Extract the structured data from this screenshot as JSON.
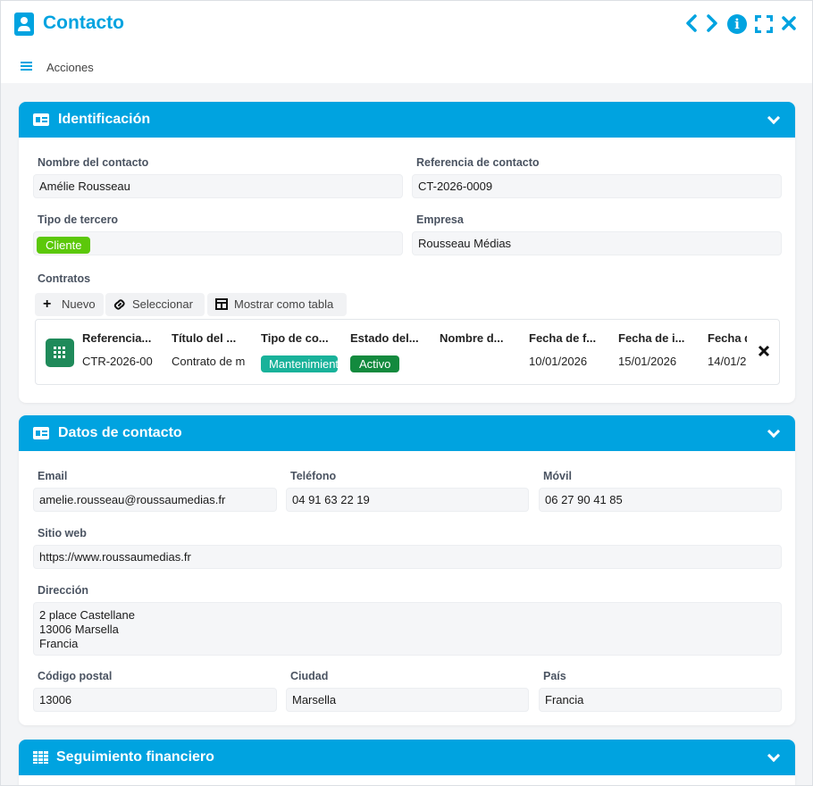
{
  "window": {
    "title": "Contacto",
    "icons": [
      "person-badge-icon",
      "chevron-left-icon",
      "chevron-right-icon",
      "info-icon",
      "fullscreen-icon",
      "close-icon"
    ]
  },
  "menubar": {
    "label": "Acciones"
  },
  "identificacion": {
    "title": "Identificación",
    "nombre_label": "Nombre del contacto",
    "nombre_value": "Amélie Rousseau",
    "referencia_label": "Referencia de contacto",
    "referencia_value": "CT-2026-0009",
    "tipo_label": "Tipo de tercero",
    "tipo_value": "Cliente",
    "empresa_label": "Empresa",
    "empresa_value": "Rousseau Médias",
    "contratos_label": "Contratos",
    "buttons": {
      "nuevo": "Nuevo",
      "seleccionar": "Seleccionar",
      "tabla": "Mostrar como tabla"
    },
    "table": {
      "headers": [
        "Referencia...",
        "Título del ...",
        "Tipo de co...",
        "Estado del...",
        "Nombre d...",
        "Fecha de f...",
        "Fecha de i...",
        "Fecha d"
      ],
      "row": [
        "CTR-2026-00",
        "Contrato de m",
        "Mantenimiento",
        "Activo",
        "",
        "10/01/2026",
        "15/01/2026",
        "14/01/2"
      ]
    }
  },
  "contacto": {
    "title": "Datos de contacto",
    "email_label": "Email",
    "email_value": "amelie.rousseau@roussaumedias.fr",
    "telefono_label": "Teléfono",
    "telefono_value": "04 91 63 22 19",
    "movil_label": "Móvil",
    "movil_value": "06 27 90 41 85",
    "web_label": "Sitio web",
    "web_value": "https://www.roussaumedias.fr",
    "direccion_label": "Dirección",
    "direccion_lines": [
      "2 place Castellane",
      "13006 Marsella",
      "Francia"
    ],
    "cp_label": "Código postal",
    "cp_value": "13006",
    "ciudad_label": "Ciudad",
    "ciudad_value": "Marsella",
    "pais_label": "País",
    "pais_value": "Francia"
  },
  "financiero": {
    "title": "Seguimiento financiero"
  },
  "colors": {
    "accent": "#00a3e0",
    "cliente": "#5cc80a",
    "activo": "#138a3e",
    "mantenimiento": "#19b29a",
    "table_icon": "#1f8a5a"
  }
}
